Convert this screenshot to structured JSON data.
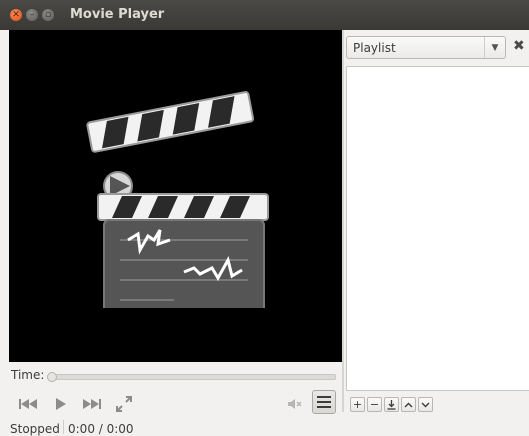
{
  "window": {
    "title": "Movie Player"
  },
  "controls": {
    "time_label": "Time:"
  },
  "status": {
    "state": "Stopped",
    "time": "0:00 / 0:00"
  },
  "playlist": {
    "selector_value": "Playlist",
    "items": []
  },
  "icons": {
    "close": "close-icon",
    "minimize": "minimize-icon",
    "maximize": "maximize-icon",
    "previous": "skip-back-icon",
    "play": "play-icon",
    "next": "skip-forward-icon",
    "fullscreen": "fullscreen-icon",
    "volume": "volume-muted-icon",
    "menu": "menu-icon",
    "add": "plus-icon",
    "remove": "minus-icon",
    "save": "save-icon",
    "up": "chevron-up-icon",
    "down": "chevron-down-icon"
  },
  "colors": {
    "titlebar": "#3c3b37",
    "close_button": "#e9561e",
    "video_bg": "#000000"
  }
}
